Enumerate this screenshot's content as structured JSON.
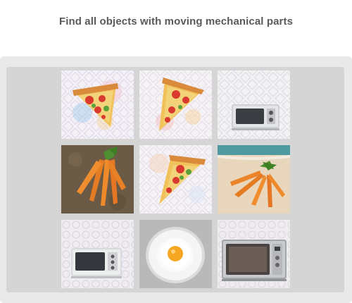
{
  "prompt": "Find all objects with moving mechanical parts",
  "tiles": [
    {
      "subject": "pizza-slice"
    },
    {
      "subject": "pizza-slice"
    },
    {
      "subject": "microwave"
    },
    {
      "subject": "carrots"
    },
    {
      "subject": "pizza-slice"
    },
    {
      "subject": "carrots"
    },
    {
      "subject": "microwave"
    },
    {
      "subject": "fried-egg"
    },
    {
      "subject": "microwave"
    }
  ]
}
